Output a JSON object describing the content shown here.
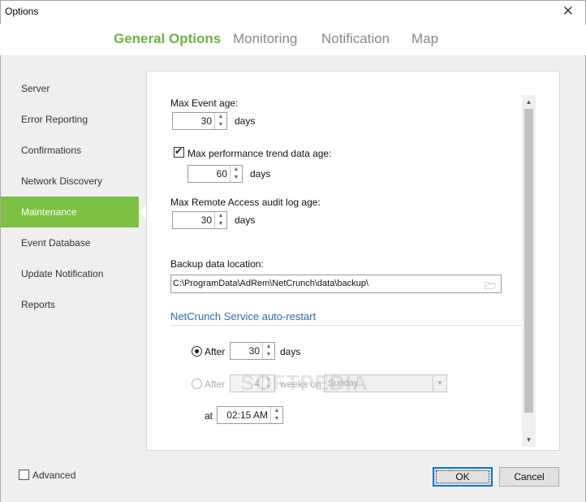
{
  "window": {
    "title": "Options",
    "close_glyph": "✕"
  },
  "tabs": [
    {
      "label": "General Options",
      "active": true
    },
    {
      "label": "Monitoring",
      "active": false
    },
    {
      "label": "Notification",
      "active": false
    },
    {
      "label": "Map",
      "active": false
    }
  ],
  "sidebar": {
    "items": [
      {
        "label": "Server",
        "active": false
      },
      {
        "label": "Error Reporting",
        "active": false
      },
      {
        "label": "Confirmations",
        "active": false
      },
      {
        "label": "Network Discovery",
        "active": false
      },
      {
        "label": "Maintenance",
        "active": true
      },
      {
        "label": "Event Database",
        "active": false
      },
      {
        "label": "Update Notification",
        "active": false
      },
      {
        "label": "Reports",
        "active": false
      }
    ],
    "accent_color": "#7dc143"
  },
  "maintenance": {
    "max_event_age_label": "Max Event age:",
    "max_event_age_value": "30",
    "max_event_age_unit": "days",
    "perf_trend_label": "Max performance trend data age:",
    "perf_trend_checked": true,
    "perf_trend_value": "60",
    "perf_trend_unit": "days",
    "remote_audit_label": "Max Remote Access audit log age:",
    "remote_audit_value": "30",
    "remote_audit_unit": "days",
    "backup_label": "Backup data location:",
    "backup_path": "C:\\ProgramData\\AdRem\\NetCrunch\\data\\backup\\",
    "autorestart_title": "NetCrunch Service auto-restart",
    "after_days_label": "After",
    "after_days_value": "30",
    "after_days_unit": "days",
    "after_weeks_label": "After",
    "after_weeks_value": "4",
    "after_weeks_unit": "weeks on",
    "weekday_value": "Sunday",
    "at_label": "at",
    "time_value": "02:15 AM"
  },
  "footer": {
    "advanced_label": "Advanced",
    "advanced_checked": false,
    "ok_label": "OK",
    "cancel_label": "Cancel"
  },
  "watermark": "SOFTPEDIA",
  "colors": {
    "active_tab": "#6cb33e",
    "section_title": "#2b6cb0",
    "primary_border": "#0078d7"
  }
}
